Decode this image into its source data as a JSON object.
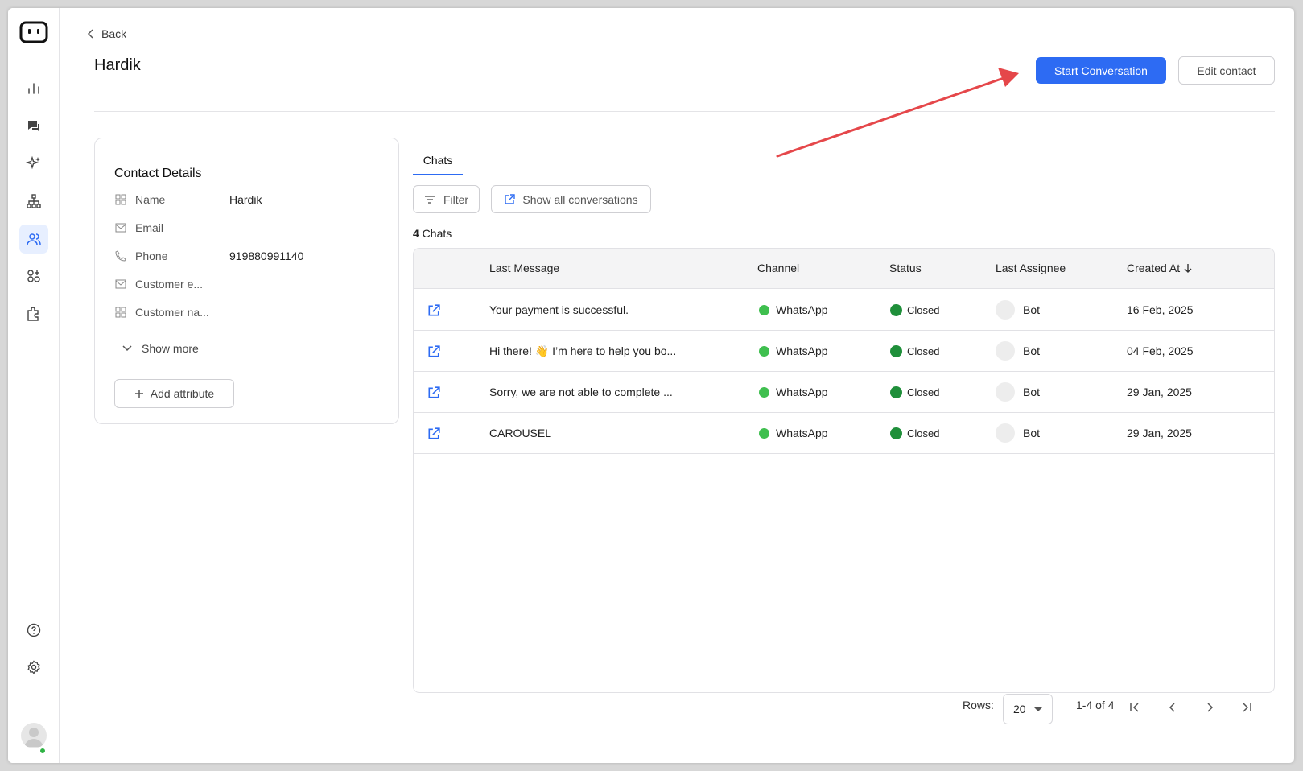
{
  "back": {
    "label": "Back"
  },
  "contact": {
    "name": "Hardik"
  },
  "actions": {
    "start_label": "Start Conversation",
    "edit_label": "Edit contact"
  },
  "details": {
    "title": "Contact Details",
    "rows": [
      {
        "icon": "grid-icon",
        "key": "Name",
        "value": "Hardik"
      },
      {
        "icon": "mail-icon",
        "key": "Email",
        "value": ""
      },
      {
        "icon": "phone-icon",
        "key": "Phone",
        "value": "919880991140"
      },
      {
        "icon": "mail-icon",
        "key": "Customer e...",
        "value": ""
      },
      {
        "icon": "grid-icon",
        "key": "Customer na...",
        "value": ""
      }
    ],
    "show_more": "Show more",
    "add_attr": "Add attribute"
  },
  "tabs": {
    "chats": "Chats"
  },
  "toolbar": {
    "filter": "Filter",
    "show_all": "Show all conversations"
  },
  "count": {
    "num": "4",
    "label": " Chats"
  },
  "table": {
    "headers": {
      "last_message": "Last Message",
      "channel": "Channel",
      "status": "Status",
      "assignee": "Last Assignee",
      "created": "Created At"
    },
    "rows": [
      {
        "message": "Your payment is successful.",
        "channel": "WhatsApp",
        "status": "Closed",
        "assignee": "Bot",
        "created": "16 Feb, 2025"
      },
      {
        "message": "Hi there! 👋 I’m here to help you bo...",
        "channel": "WhatsApp",
        "status": "Closed",
        "assignee": "Bot",
        "created": "04 Feb, 2025"
      },
      {
        "message": "Sorry, we are not able to complete ...",
        "channel": "WhatsApp",
        "status": "Closed",
        "assignee": "Bot",
        "created": "29 Jan, 2025"
      },
      {
        "message": "CAROUSEL",
        "channel": "WhatsApp",
        "status": "Closed",
        "assignee": "Bot",
        "created": "29 Jan, 2025"
      }
    ]
  },
  "pagination": {
    "rows_label": "Rows:",
    "rows_value": "20",
    "range": "1-4 of 4"
  },
  "colors": {
    "primary": "#2d6bf3",
    "annotation_arrow": "#e5474a",
    "status_closed": "#1f8f3a",
    "whatsapp": "#3fbf4f"
  }
}
